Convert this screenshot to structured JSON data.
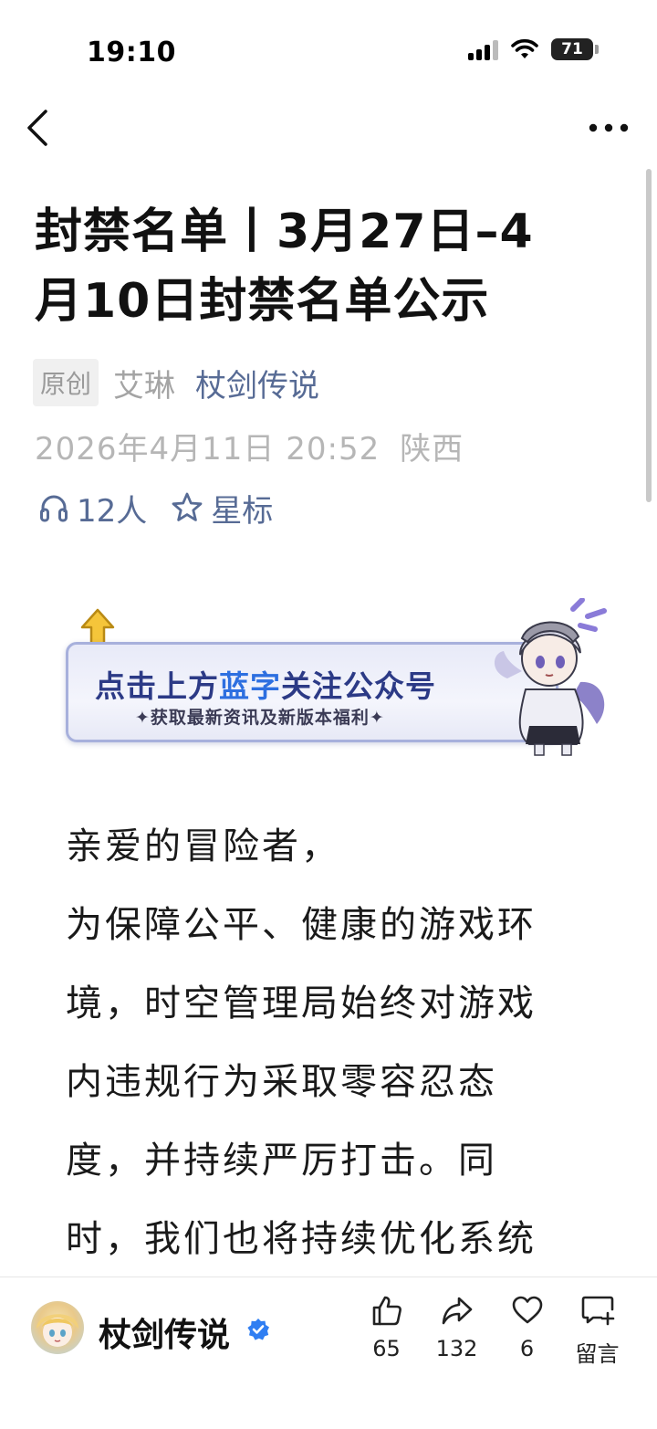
{
  "status_bar": {
    "time": "19:10",
    "battery": "71"
  },
  "nav": {
    "back_icon": "chevron-left-icon",
    "more_icon": "more-horizontal-icon"
  },
  "article": {
    "title_line1": "封禁名单丨3月27日–4",
    "title_line2": "月10日封禁名单公示",
    "original_tag": "原创",
    "author": "艾琳",
    "account": "杖剑传说",
    "date": "2026年4月11日 20:52",
    "location": "陕西",
    "listen_count": "12人",
    "star_label": "星标"
  },
  "banner": {
    "headline_part1": "点击上方",
    "headline_highlight": "蓝字",
    "headline_part2": "关注公众号",
    "subline": "✦获取最新资讯及新版本福利✦"
  },
  "body": {
    "lines": [
      "亲爱的冒险者，",
      "为保障公平、健康的游戏环",
      "境，时空管理局始终对游戏",
      "内违规行为采取零容忍态",
      "度，并持续严厉打击。同",
      "时，我们也将持续优化系统"
    ]
  },
  "bottom_bar": {
    "account_name": "杖剑传说",
    "like_count": "65",
    "share_count": "132",
    "favorite_count": "6",
    "comment_label": "留言"
  },
  "colors": {
    "link": "#576b95",
    "muted": "#b6b6b6",
    "verified": "#2f7ef2",
    "banner_blue": "#2d6fe0"
  }
}
